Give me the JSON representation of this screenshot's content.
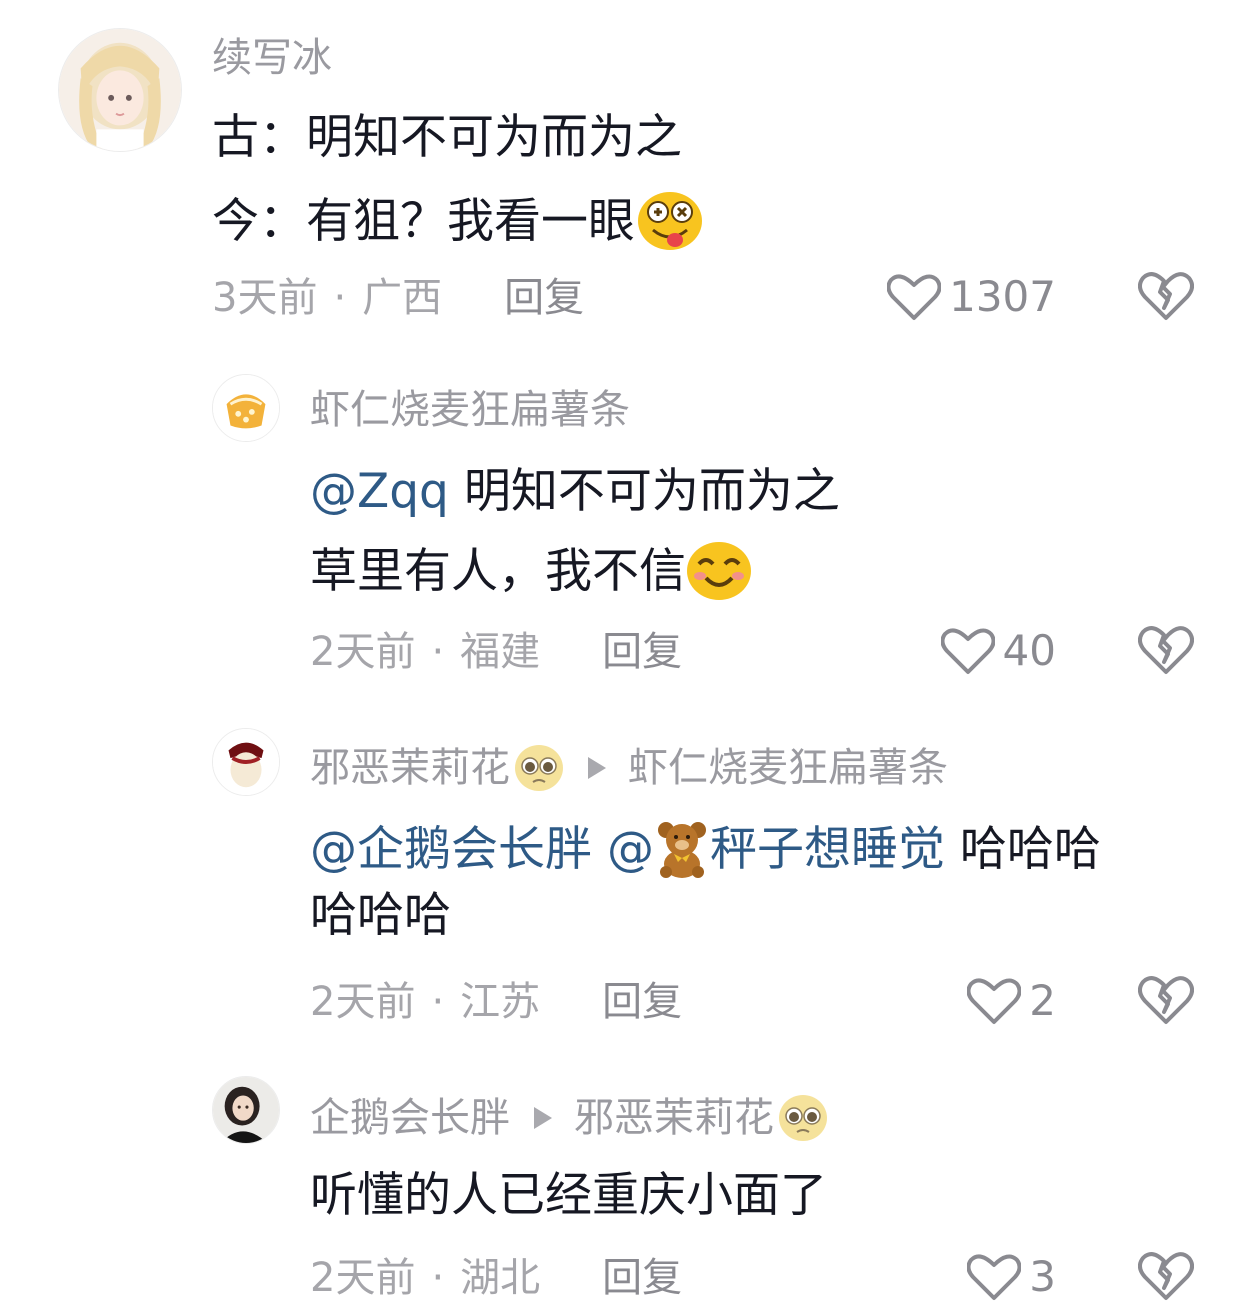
{
  "comments": [
    {
      "username": "续写冰",
      "lines": [
        "古：明知不可为而为之",
        "今：有狙？我看一眼"
      ],
      "line2_emoji": "drooling-dizzy-face-emoji",
      "time": "3天前",
      "location": "广西",
      "reply_label": "回复",
      "likes": "1307"
    },
    {
      "username": "虾仁烧麦狂扁薯条",
      "mention": "@Zqq",
      "lines": [
        " 明知不可为而为之",
        "草里有人，我不信"
      ],
      "line2_emoji": "smiling-face-emoji",
      "time": "2天前",
      "location": "福建",
      "reply_label": "回复",
      "likes": "40"
    },
    {
      "username": "邪恶茉莉花",
      "username_emoji": "pleading-face-emoji",
      "reply_to": "虾仁烧麦狂扁薯条",
      "mention1": "@企鹅会长胖",
      "mention2_prefix": " @",
      "mention2_emoji": "teddy-bear-emoji",
      "mention2": "秤子想睡觉",
      "text_tail": " 哈哈哈",
      "line2": "哈哈哈",
      "time": "2天前",
      "location": "江苏",
      "reply_label": "回复",
      "likes": "2"
    },
    {
      "username": "企鹅会长胖",
      "reply_to": "邪恶茉莉花",
      "reply_to_emoji": "pleading-face-emoji",
      "lines": [
        "听懂的人已经重庆小面了"
      ],
      "time": "2天前",
      "location": "湖北",
      "reply_label": "回复",
      "likes": "3"
    }
  ],
  "meta_separator": "·",
  "colors": {
    "username": "#9a9aa0",
    "mention": "#2e5a86",
    "text": "#161823",
    "meta": "#a5a5aa"
  }
}
